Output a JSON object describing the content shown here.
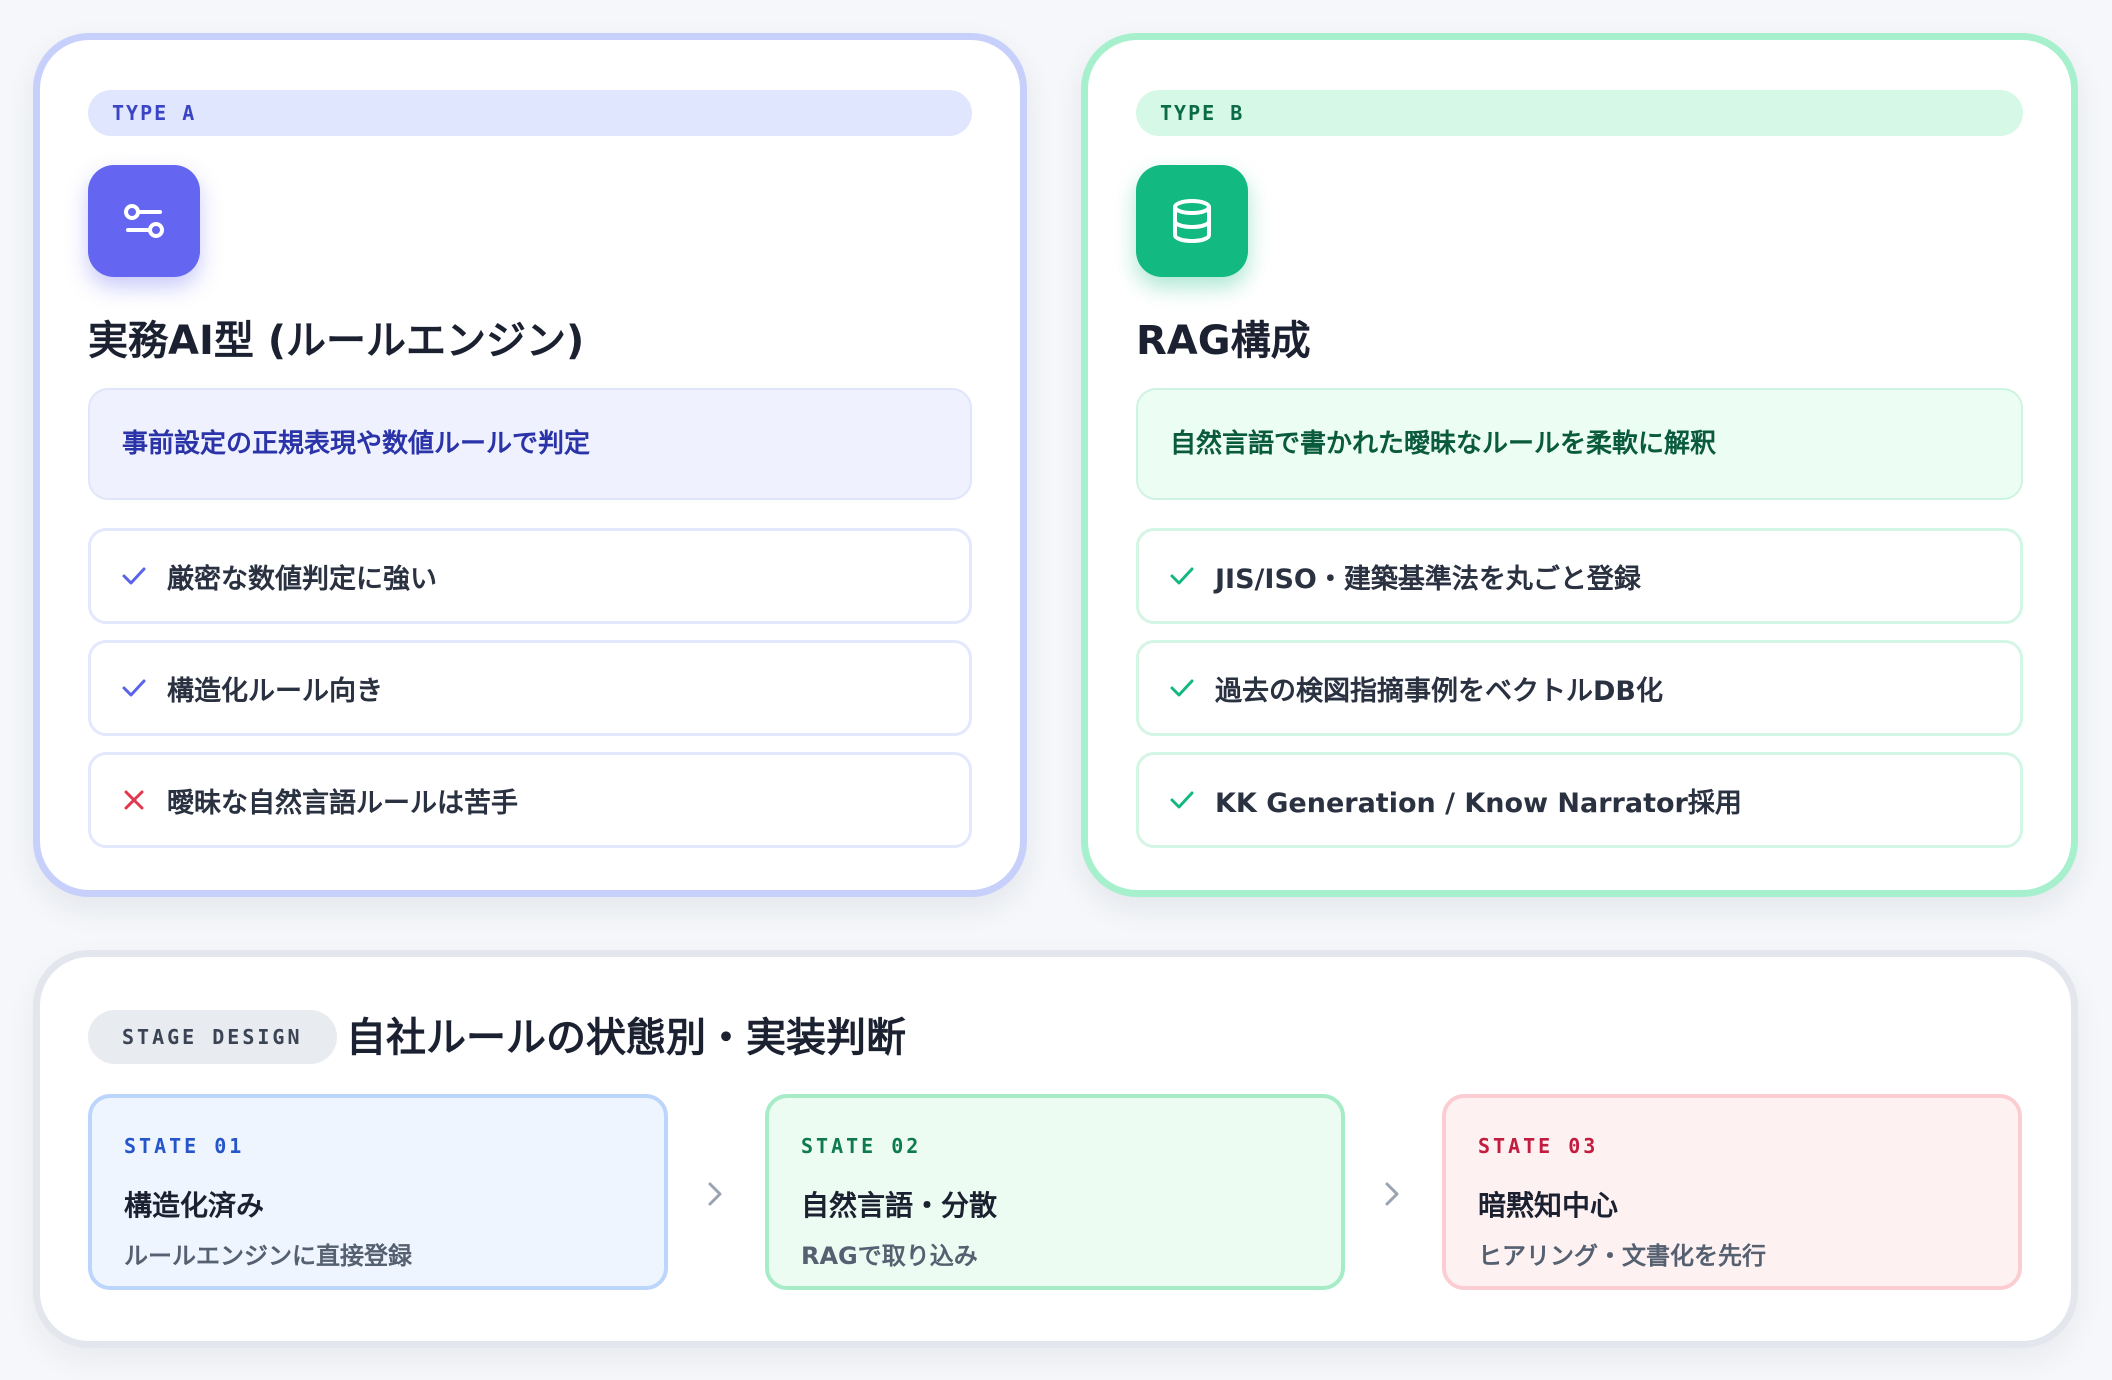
{
  "type_a": {
    "tag": "TYPE A",
    "icon": "sliders-icon",
    "title": "実務AI型 (ルールエンジン)",
    "description": "事前設定の正規表現や数値ルールで判定",
    "items": [
      {
        "mark": "check-icon",
        "text": "厳密な数値判定に強い"
      },
      {
        "mark": "check-icon",
        "text": "構造化ルール向き"
      },
      {
        "mark": "cross-icon",
        "text": "曖昧な自然言語ルールは苦手"
      }
    ],
    "accent": "#6466f1"
  },
  "type_b": {
    "tag": "TYPE B",
    "icon": "database-icon",
    "title": "RAG構成",
    "description": "自然言語で書かれた曖昧なルールを柔軟に解釈",
    "items": [
      {
        "mark": "check-icon",
        "text": "JIS/ISO・建築基準法を丸ごと登録"
      },
      {
        "mark": "check-icon",
        "text": "過去の検図指摘事例をベクトルDB化"
      },
      {
        "mark": "check-icon",
        "text": "KK Generation / Know Narrator採用"
      }
    ],
    "accent": "#12b981"
  },
  "stage": {
    "chip": "STAGE DESIGN",
    "title": "自社ルールの状態別・実装判断",
    "states": [
      {
        "label": "STATE 01",
        "title": "構造化済み",
        "subtitle": "ルールエンジンに直接登録",
        "color": "#2456c9"
      },
      {
        "label": "STATE 02",
        "title": "自然言語・分散",
        "subtitle": "RAGで取り込み",
        "color": "#0f7a4f"
      },
      {
        "label": "STATE 03",
        "title": "暗黙知中心",
        "subtitle": "ヒアリング・文書化を先行",
        "color": "#c21d3f"
      }
    ],
    "arrow_icon": "chevron-right-icon"
  }
}
